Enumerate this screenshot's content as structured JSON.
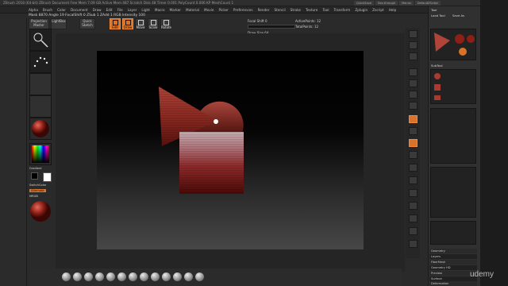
{
  "app": {
    "title_bar_text": "ZBrush 2018 (64-bit)   ZBrush Document   Free Mem 7.09 GB   Active Mem 487   Scratch Disk 48   Timer 0.001   PolyCount 0.006 KP   MeshCount 1",
    "title_buttons": [
      "QuickSave",
      "See-through",
      "Menus",
      "DefaultZScript"
    ],
    "menu_items": [
      "Alpha",
      "Brush",
      "Color",
      "Document",
      "Draw",
      "Edit",
      "File",
      "Layer",
      "Light",
      "Macro",
      "Marker",
      "Material",
      "Movie",
      "Picker",
      "Preferences",
      "Render",
      "Stencil",
      "Stroke",
      "Texture",
      "Tool",
      "Transform",
      "Zplugin",
      "Zscript",
      "Help"
    ]
  },
  "info_bar": {
    "text": "Mask 8870   Angle 19   FocalShift 0   ZSub 1   ZAdd 1   RGB Intensity 100",
    "accent": "#e0824a"
  },
  "shelf": {
    "projection_master": "Projection Master",
    "lightbox": "LightBox",
    "quick_sketch": "Quick Sketch",
    "edit": "Edit",
    "draw": "Draw",
    "move": "Move",
    "scale": "Scale",
    "rotate": "Rotate",
    "focal_shift": "Focal Shift 0",
    "draw_size": "Draw Size 64",
    "active_points": "ActivePoints: 12",
    "total_points": "TotalPoints: 12"
  },
  "left_tray": {
    "gradient_label": "Gradient",
    "switch_color_label": "SwitchColor",
    "alternate_label": "Alternate",
    "mrgb_label": "MRGB"
  },
  "right_tray": {
    "tool_header": "Tool",
    "load_tool": "Load Tool",
    "save_as": "Save As",
    "subtool_header": "SubTool",
    "rows": [
      "Geometry",
      "Layers",
      "FiberMesh",
      "Geometry HD",
      "Preview",
      "Surface",
      "Deformation"
    ]
  },
  "watermark": {
    "text": "udemy"
  },
  "colors": {
    "accent_orange": "#d9732a",
    "panel": "#303030",
    "background": "#2a2a2a",
    "canvas_top": "#000000",
    "canvas_bottom": "#474747"
  },
  "icons": [
    "standard-brush-icon",
    "dots-stroke-icon",
    "alpha-icon",
    "texture-icon",
    "material-sphere-icon",
    "color-picker-icon"
  ]
}
